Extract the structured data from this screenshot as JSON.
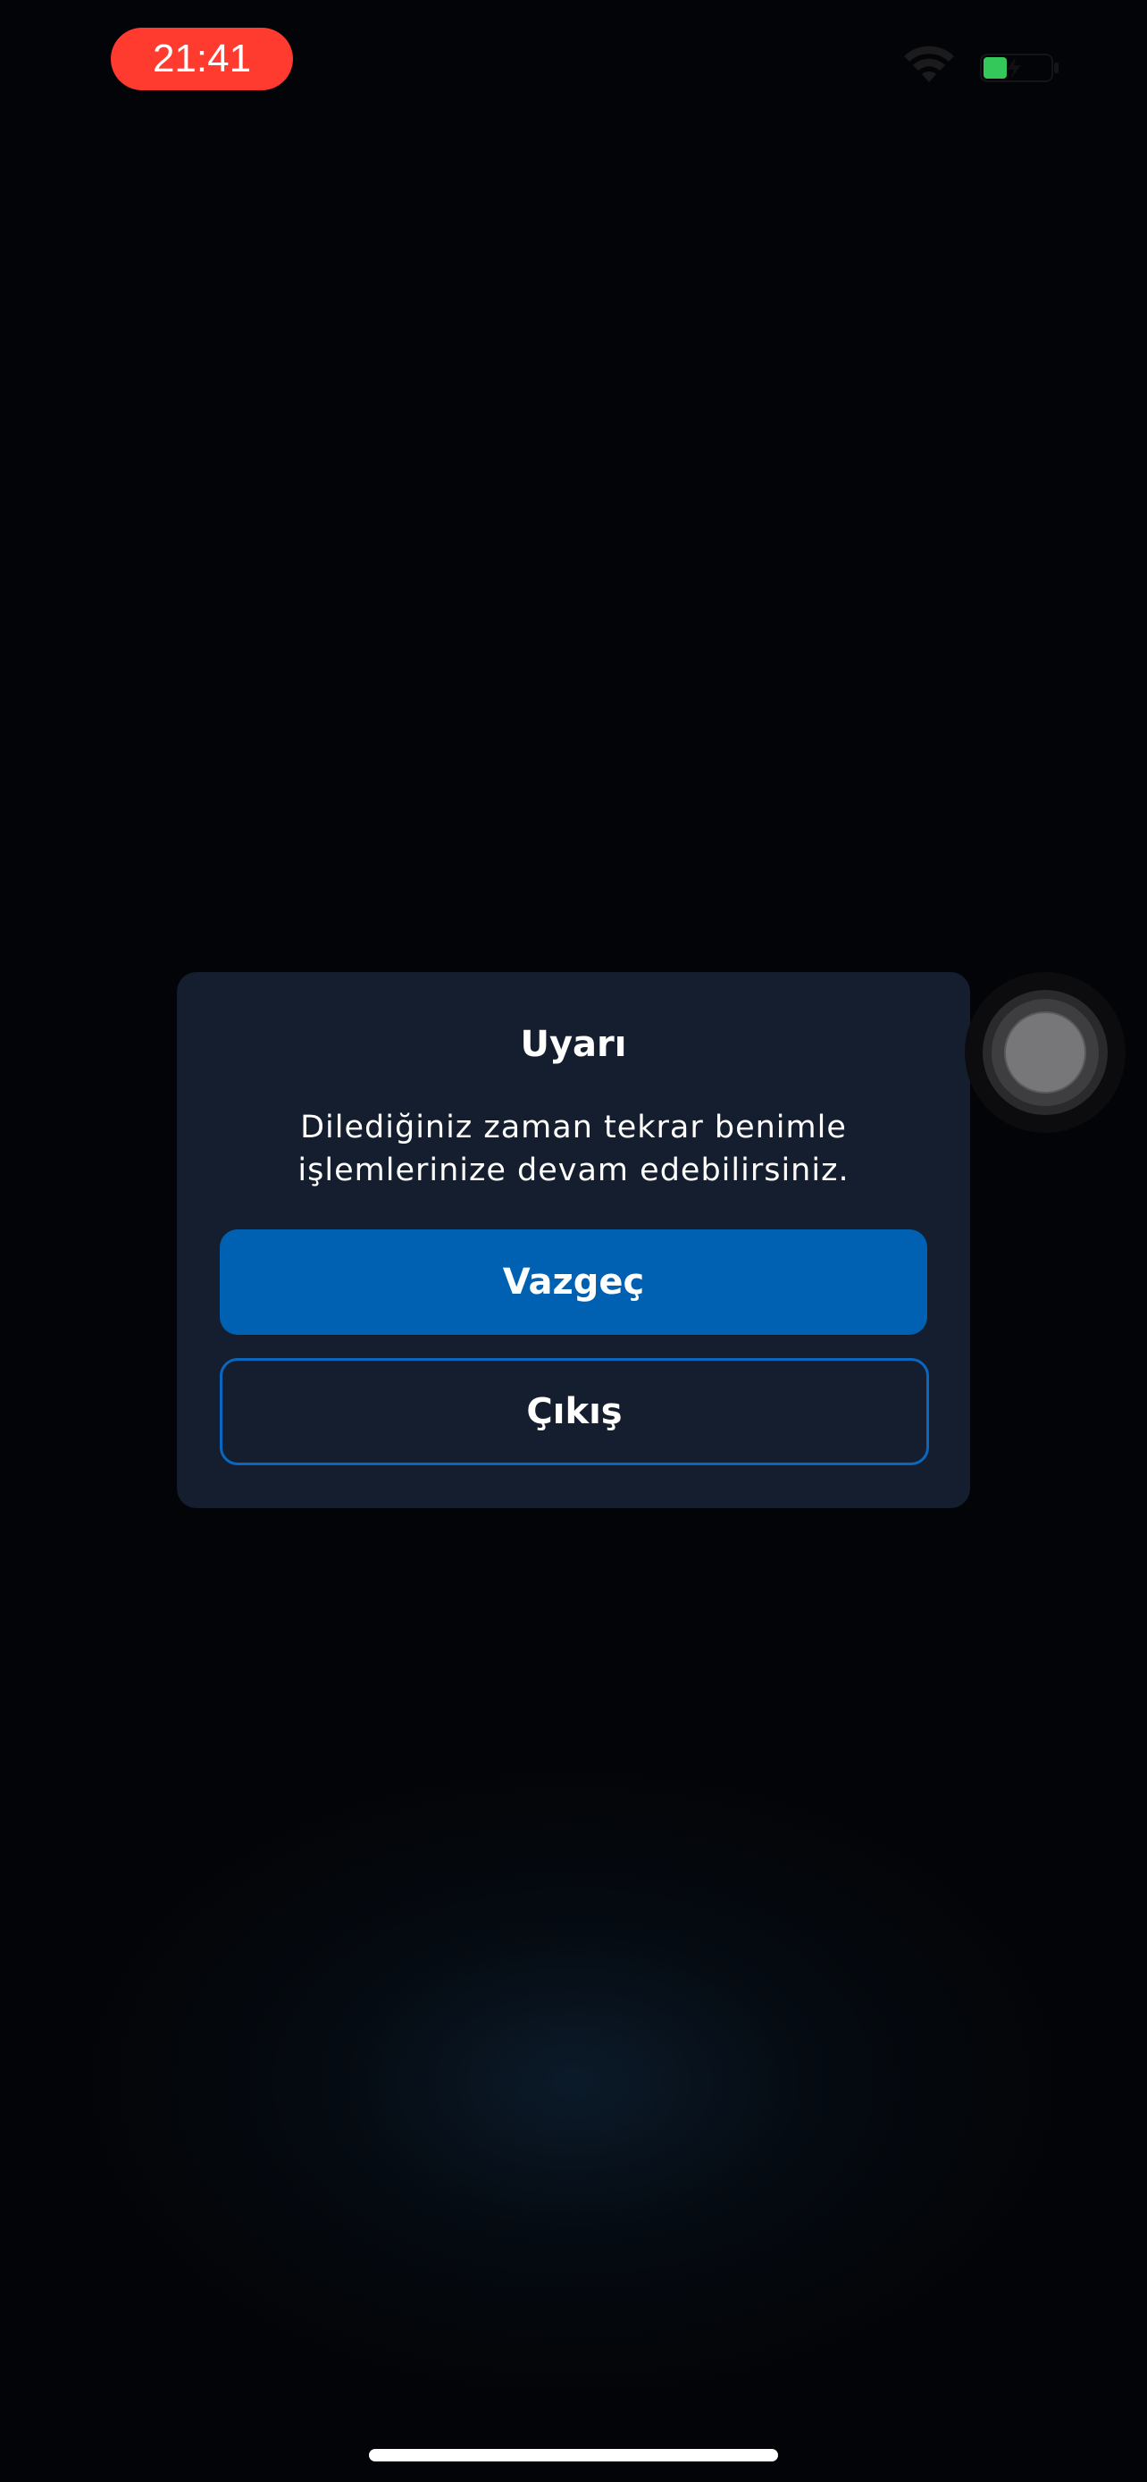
{
  "status_bar": {
    "time": "21:41",
    "time_pill_color": "#ff3b30",
    "wifi_icon": "wifi-icon",
    "battery_icon": "battery-charging-icon",
    "battery_color": "#34c759"
  },
  "dialog": {
    "title": "Uyarı",
    "message_line1": "Dilediğiniz zaman tekrar benimle",
    "message_line2": "işlemlerinize devam edebilirsiniz.",
    "primary_button_label": "Vazgeç",
    "secondary_button_label": "Çıkış",
    "background_color": "#141e2e",
    "accent_color": "#0060b2"
  },
  "assistive_touch": {
    "icon": "assistive-touch-icon"
  }
}
